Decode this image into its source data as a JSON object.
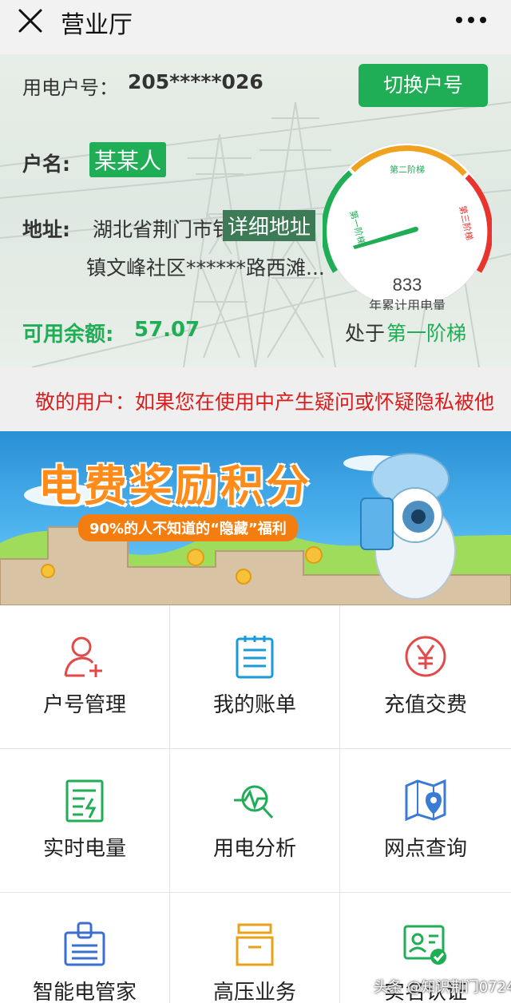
{
  "nav": {
    "title": "营业厅",
    "close_icon": "close-icon",
    "more_icon": "more-icon"
  },
  "account": {
    "number_label": "用电户号：",
    "number": "205*****026",
    "switch_label": "切换户号",
    "name_label": "户名:",
    "name": "某某人",
    "address_label": "地址:",
    "address_line1": "湖北省荆门市钅",
    "address_mask": "详细地址",
    "address_line2": "镇文峰社区******路西滩...",
    "balance_label": "可用余额:",
    "balance": "57.07",
    "tier_prefix": "处于",
    "tier": "第一阶梯"
  },
  "gauge": {
    "tier1": "第一阶梯",
    "tier2": "第二阶梯",
    "tier3": "第三阶梯",
    "value": "833",
    "label": "年累计用电量",
    "colors": {
      "tier1": "#1fae55",
      "tier2": "#f0a21e",
      "tier3": "#e8342f",
      "needle": "#1fae55"
    }
  },
  "notice": {
    "text": "敬的用户：如果您在使用中产生疑问或怀疑隐私被他"
  },
  "banner": {
    "title": "电费奖励积分",
    "subtitle": "90%的人不知道的“隐藏”福利"
  },
  "services": [
    {
      "label": "户号管理",
      "icon": "user-add-icon",
      "color": "#e24a4a"
    },
    {
      "label": "我的账单",
      "icon": "bill-icon",
      "color": "#1a9bd6"
    },
    {
      "label": "充值交费",
      "icon": "yuan-icon",
      "color": "#e24a4a"
    },
    {
      "label": "实时电量",
      "icon": "realtime-power-icon",
      "color": "#1fae55"
    },
    {
      "label": "用电分析",
      "icon": "analysis-icon",
      "color": "#1fae55"
    },
    {
      "label": "网点查询",
      "icon": "map-location-icon",
      "color": "#3a7bd5"
    },
    {
      "label": "智能电管家",
      "icon": "smart-manager-icon",
      "color": "#3a6fd0"
    },
    {
      "label": "高压业务",
      "icon": "high-voltage-box-icon",
      "color": "#e8a21a"
    },
    {
      "label": "实名认证",
      "icon": "id-verify-icon",
      "color": "#1fae55"
    }
  ],
  "watermark": "头条 @知识荆门0724",
  "colors": {
    "accent": "#1fae55",
    "notice": "#d81e1e",
    "banner_orange": "#ff8c1a"
  }
}
